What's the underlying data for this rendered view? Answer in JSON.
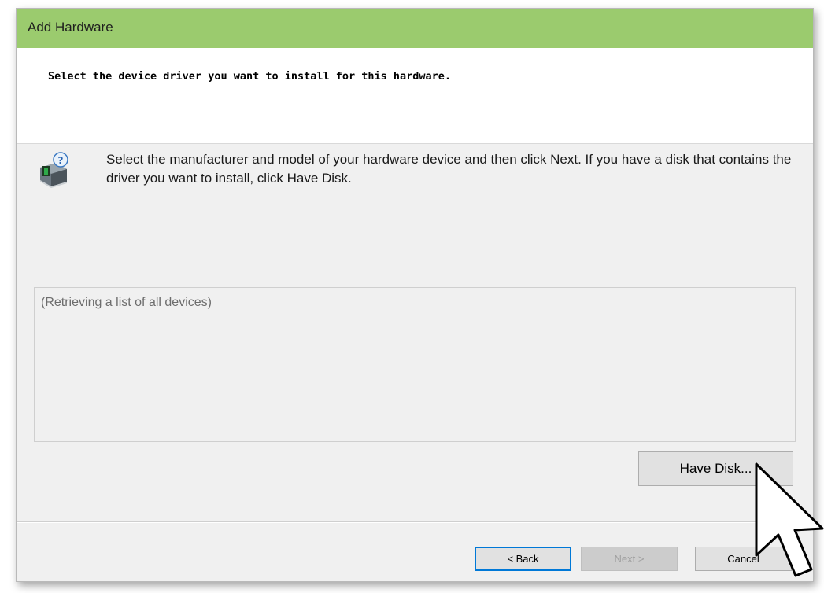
{
  "window": {
    "title": "Add Hardware"
  },
  "header": {
    "heading": "Select the device driver you want to install for this hardware."
  },
  "body": {
    "icon": "hardware-help-icon",
    "instruction": "Select the manufacturer and model of your hardware device and then click Next. If you have a disk that contains the driver you want to install, click Have Disk."
  },
  "device_list": {
    "status_text": "(Retrieving a list of all devices)"
  },
  "buttons": {
    "have_disk": "Have Disk...",
    "back": "< Back",
    "next": "Next >",
    "cancel": "Cancel"
  },
  "colors": {
    "title_bar": "#9bcb6e",
    "focus_border": "#0078d7"
  }
}
